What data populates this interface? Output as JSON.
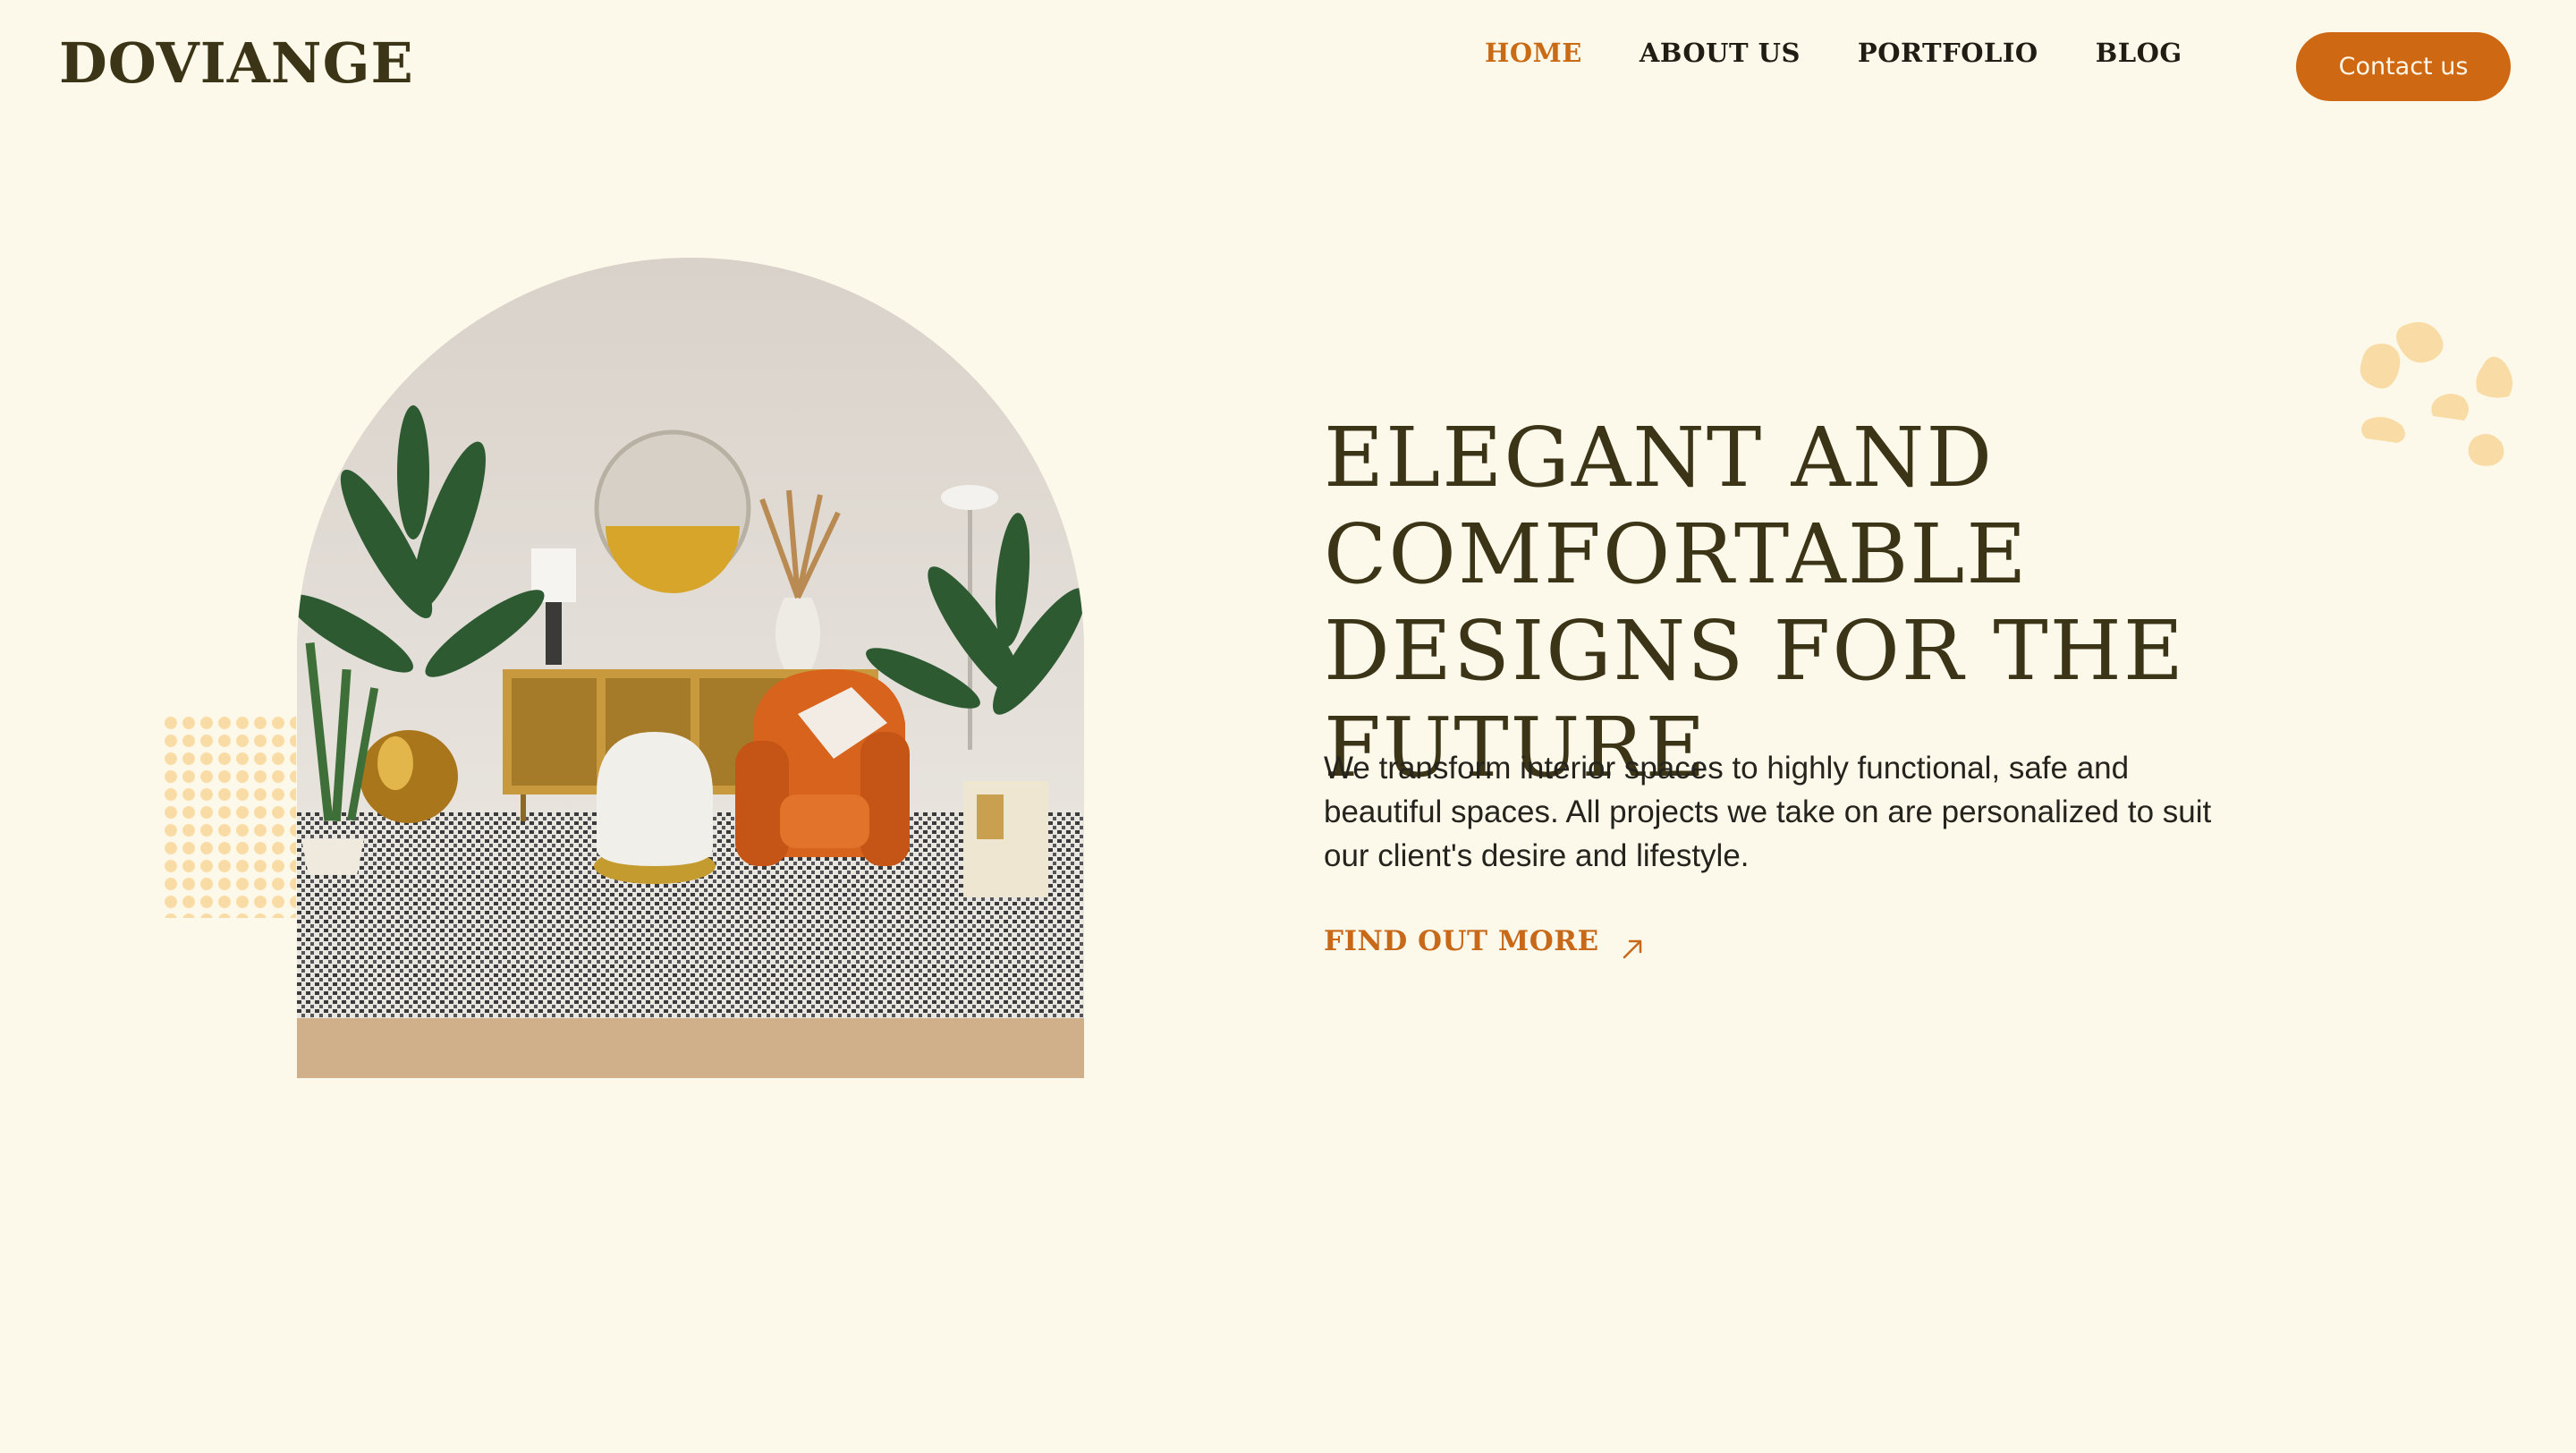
{
  "header": {
    "logo": "DOVIANGE",
    "nav": [
      {
        "label": "HOME",
        "active": true
      },
      {
        "label": "ABOUT US",
        "active": false
      },
      {
        "label": "PORTFOLIO",
        "active": false
      },
      {
        "label": "BLOG",
        "active": false
      }
    ],
    "contact_label": "Contact us"
  },
  "hero": {
    "headline": "Elegant And Comfortable Designs for the Future",
    "description": "We transform interior spaces to highly functional, safe and beautiful spaces. All projects we take on are personalized to suit our client's desire and lifestyle.",
    "cta_label": "FIND OUT MORE",
    "cta_icon": "arrow-up-right-icon",
    "image_icon": "living-room-photo"
  },
  "colors": {
    "background": "#fdf9ea",
    "accent": "#cf6812",
    "text_dark": "#3b3416",
    "decor": "#f9dca5"
  }
}
